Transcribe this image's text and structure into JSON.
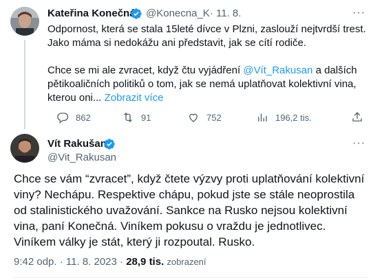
{
  "quoted_tweet": {
    "author_name": "Kateřina Konečná",
    "handle": "@Konecna_K",
    "separator": "·",
    "date": "11. 8.",
    "more_label": "···",
    "text_p1": "Odpornost, která se stala 15leté dívce v Plzni, zaslouží nejtvrdší trest. Jako máma si nedokážu ani představit, jak se cítí rodiče.",
    "text_p2_before": "Chce se mi ale zvracet, když čtu vyjádření ",
    "text_p2_mention": "@Vít_Rakusan",
    "text_p2_after": " a dalších pětikoaličních politiků o tom, jak se nemá uplatňovat kolektivní vina, kterou oni...",
    "show_more": "Zobrazit více",
    "stats": {
      "replies": "862",
      "retweets": "91",
      "likes": "752",
      "views": "196,2 tis."
    }
  },
  "main_tweet": {
    "author_name": "Vít Rakušan",
    "handle": "@Vit_Rakusan",
    "more_label": "···",
    "text": "Chce se vám “zvracet”, když čtete výzvy proti uplatňování kolektivní viny? Nechápu. Respektive chápu, pokud jste se stále neoprostila od stalinistického uvažování. Sankce na Rusko nejsou kolektivní vina, paní Konečná. Viníkem pokusu o vraždu je jednotlivec. Viníkem války je stát, který ji rozpoutal. Rusko.",
    "time": "9:42 odp.",
    "separator": "·",
    "date": "11. 8. 2023",
    "views_count": "28,9 tis.",
    "views_label": "zobrazení"
  },
  "colors": {
    "verified": "#1d9bf0",
    "link": "#1d9bf0",
    "secondary_text": "#536471"
  }
}
